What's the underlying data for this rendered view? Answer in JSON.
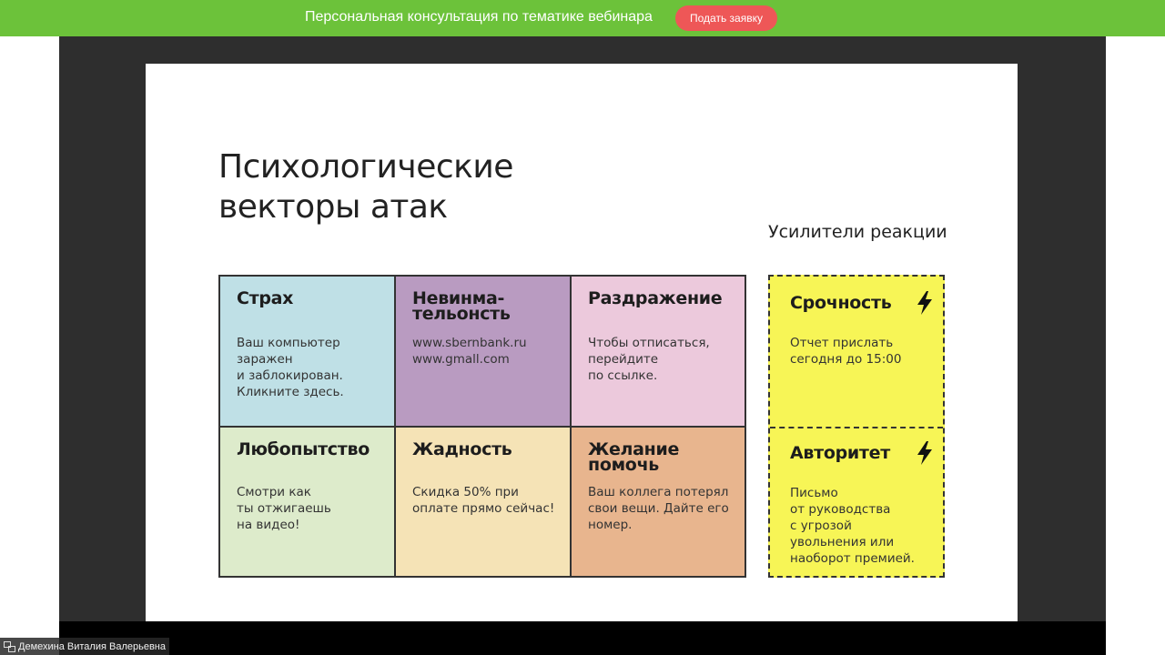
{
  "banner": {
    "text": "Персональная консультация по тематике вебинара",
    "button_label": "Подать заявку"
  },
  "slide": {
    "title_line1": "Психологические",
    "title_line2": "векторы атак",
    "amplifiers_title": "Усилители реакции",
    "vectors": [
      {
        "title": "Страх",
        "text": "Ваш компьютер\nзаражен\nи заблокирован.\nКликните здесь.",
        "color": "#bfe0e6"
      },
      {
        "title": "Невинма-\nтельонсть",
        "text": "www.sbernbank.ru\nwww.gmall.com",
        "color": "#b99bc1"
      },
      {
        "title": "Раздражение",
        "text": "Чтобы отписаться,\nперейдите\nпо ссылке.",
        "color": "#ecc9dc"
      },
      {
        "title": "Любопытство",
        "text": "Смотри как\nты отжигаешь\nна видео!",
        "color": "#ddebcb"
      },
      {
        "title": "Жадность",
        "text": "Скидка 50% при\nоплате прямо сейчас!",
        "color": "#f5e3b6"
      },
      {
        "title": "Желание\nпомочь",
        "text": "Ваш коллега потерял\nсвои вещи. Дайте его\nномер.",
        "color": "#e8b58e"
      }
    ],
    "amplifiers": [
      {
        "title": "Срочность",
        "text": "Отчет прислать\nсегодня до 15:00",
        "icon": "lightning-icon"
      },
      {
        "title": "Авторитет",
        "text": "Письмо\nот руководства\nс угрозой\nувольнения или\nнаоборот премией.",
        "icon": "lightning-icon"
      }
    ],
    "amplifier_color": "#f7f556"
  },
  "presenter": {
    "name": "Демехина Виталия Валерьевна",
    "icon": "presenter-icon"
  }
}
